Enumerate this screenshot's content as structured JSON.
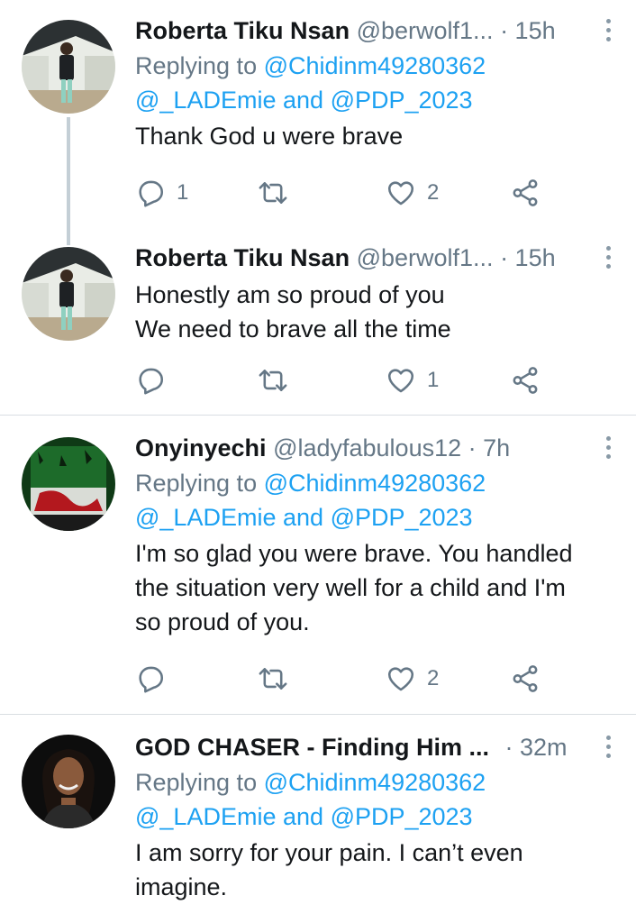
{
  "tweets": [
    {
      "name": "Roberta Tiku Nsan",
      "handle": "@berwolf1...",
      "time": "· 15h",
      "replying_prefix": "Replying to",
      "replying_line1_mention": "@Chidinm49280362",
      "replying_line2_mention_a": "@_LADEmie",
      "replying_line2_and": "and",
      "replying_line2_mention_b": "@PDP_2023",
      "text_lines": [
        "Thank God u were brave"
      ],
      "reply_count": "1",
      "retweet_count": "",
      "like_count": "2"
    },
    {
      "name": "Roberta Tiku Nsan",
      "handle": "@berwolf1...",
      "time": "· 15h",
      "text_lines": [
        "Honestly am so proud of you",
        "We need to brave all the time"
      ],
      "reply_count": "",
      "retweet_count": "",
      "like_count": "1"
    },
    {
      "name": "Onyinyechi",
      "handle": "@ladyfabulous12",
      "time": "· 7h",
      "replying_prefix": "Replying to",
      "replying_line1_mention": "@Chidinm49280362",
      "replying_line2_mention_a": "@_LADEmie",
      "replying_line2_and": "and",
      "replying_line2_mention_b": "@PDP_2023",
      "text_lines": [
        "I'm so glad you were brave. You handled",
        "the situation very well for a child and I'm",
        "so proud of you."
      ],
      "reply_count": "",
      "retweet_count": "",
      "like_count": "2"
    },
    {
      "name": "GOD CHASER - Finding Him ...",
      "handle": "",
      "time": "· 32m",
      "replying_prefix": "Replying to",
      "replying_line1_mention": "@Chidinm49280362",
      "replying_line2_mention_a": "@_LADEmie",
      "replying_line2_and": "and",
      "replying_line2_mention_b": "@PDP_2023",
      "text_lines": [
        "I am sorry for your pain. I can’t even",
        "imagine."
      ]
    }
  ],
  "icons": {
    "reply": "reply-icon",
    "retweet": "retweet-icon",
    "like": "heart-icon",
    "share": "share-icon",
    "more": "more-vertical-icon"
  },
  "colors": {
    "mention": "#1da1f2",
    "secondary_text": "#657786",
    "divider": "#d9dee2",
    "thread_line": "#c4cfd6"
  }
}
